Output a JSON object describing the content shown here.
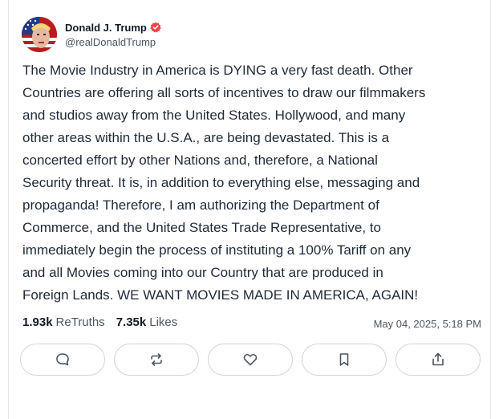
{
  "author": {
    "display_name": "Donald J. Trump",
    "handle": "@realDonaldTrump",
    "verified_color": "#ef4444"
  },
  "post": {
    "text": "The Movie Industry in America is DYING a very fast death. Other\nCountries are offering all sorts of incentives to draw our filmmakers\nand studios away from the United States. Hollywood, and many\nother areas within the U.S.A., are being devastated. This is a\nconcerted effort by other Nations and, therefore, a National\nSecurity threat. It is, in addition to everything else, messaging and\npropaganda! Therefore, I am authorizing the Department of\nCommerce, and the United States Trade Representative, to\nimmediately begin the process of instituting a 100% Tariff on any\nand all Movies coming into our Country that are produced in\nForeign Lands. WE WANT MOVIES MADE IN AMERICA, AGAIN!"
  },
  "stats": {
    "retruths_count": "1.93k",
    "retruths_label": "ReTruths",
    "likes_count": "7.35k",
    "likes_label": "Likes",
    "timestamp": "May 04, 2025, 5:18 PM"
  },
  "actions": [
    {
      "icon": "reply-icon"
    },
    {
      "icon": "retruth-icon"
    },
    {
      "icon": "like-icon"
    },
    {
      "icon": "bookmark-icon"
    },
    {
      "icon": "share-icon"
    }
  ]
}
